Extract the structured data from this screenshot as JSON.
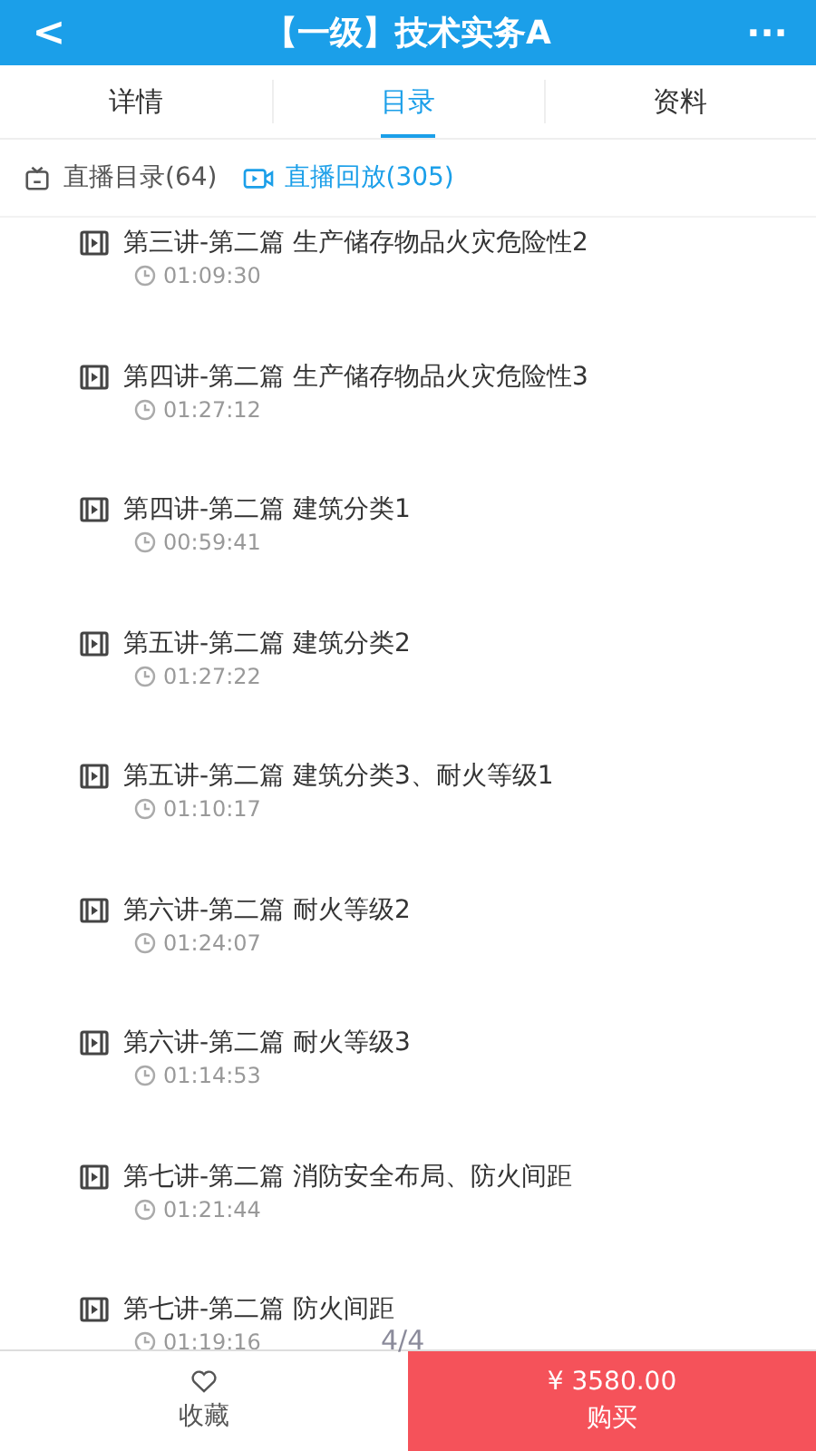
{
  "header": {
    "back": "<",
    "title": "【一级】技术实务A",
    "more": "···"
  },
  "tabs": [
    {
      "label": "详情",
      "selected": false
    },
    {
      "label": "目录",
      "selected": true
    },
    {
      "label": "资料",
      "selected": false
    }
  ],
  "subtabs": [
    {
      "label": "直播目录(64)",
      "selected": false
    },
    {
      "label": "直播回放(305)",
      "selected": true
    }
  ],
  "lessons": [
    {
      "title": "第三讲-第二篇 生产储存物品火灾危险性2",
      "duration": "01:09:30"
    },
    {
      "title": "第四讲-第二篇 生产储存物品火灾危险性3",
      "duration": "01:27:12"
    },
    {
      "title": "第四讲-第二篇 建筑分类1",
      "duration": "00:59:41"
    },
    {
      "title": "第五讲-第二篇 建筑分类2",
      "duration": "01:27:22"
    },
    {
      "title": "第五讲-第二篇 建筑分类3、耐火等级1",
      "duration": "01:10:17"
    },
    {
      "title": "第六讲-第二篇 耐火等级2",
      "duration": "01:24:07"
    },
    {
      "title": "第六讲-第二篇 耐火等级3",
      "duration": "01:14:53"
    },
    {
      "title": "第七讲-第二篇 消防安全布局、防火间距",
      "duration": "01:21:44"
    },
    {
      "title": "第七讲-第二篇 防火间距",
      "duration": "01:19:16"
    }
  ],
  "page_indicator": "4/4",
  "footer": {
    "favorite": "收藏",
    "price": "¥ 3580.00",
    "buy": "购买"
  }
}
